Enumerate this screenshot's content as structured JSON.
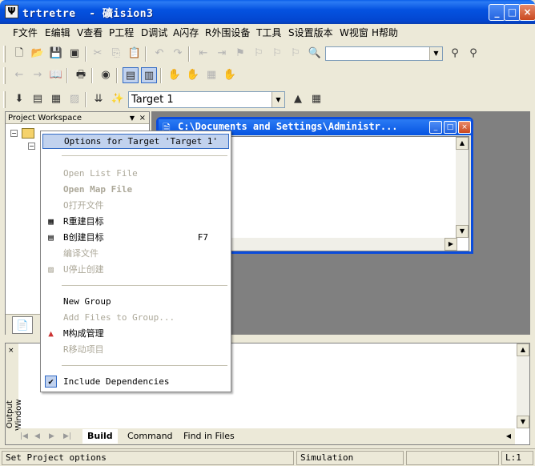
{
  "window": {
    "title": "trtretre  - 礦ision3",
    "app_icon": "Ψ",
    "controls": {
      "minimize": "_",
      "maximize": "□",
      "close": "×"
    }
  },
  "menubar": [
    {
      "label": "F文件"
    },
    {
      "label": "E编辑"
    },
    {
      "label": "V查看"
    },
    {
      "label": "P工程"
    },
    {
      "label": "D调试"
    },
    {
      "label": "A闪存"
    },
    {
      "label": "R外围设备"
    },
    {
      "label": "T工具"
    },
    {
      "label": "S设置版本"
    },
    {
      "label": "W视窗"
    },
    {
      "label": "H帮助"
    }
  ],
  "toolbar": {
    "find_combo_value": "",
    "target_combo_value": "Target 1"
  },
  "project_workspace": {
    "title": "Project Workspace",
    "close": "×"
  },
  "editor_window": {
    "title": "C:\\Documents and Settings\\Administr..."
  },
  "context_menu": {
    "items": [
      {
        "label": "Options for Target 'Target 1'",
        "shortcut": "",
        "enabled": true,
        "highlighted": true,
        "icon": ""
      },
      {
        "label": "Open List File",
        "shortcut": "",
        "enabled": false,
        "icon": ""
      },
      {
        "label": "Open Map File",
        "shortcut": "",
        "enabled": false,
        "icon": ""
      },
      {
        "label": "O打开文件",
        "shortcut": "",
        "enabled": false,
        "icon": ""
      },
      {
        "label": "R重建目标",
        "shortcut": "",
        "enabled": true,
        "icon": "rebuild-icon"
      },
      {
        "label": "B创建目标",
        "shortcut": "F7",
        "enabled": true,
        "icon": "build-icon"
      },
      {
        "label": "编译文件",
        "shortcut": "",
        "enabled": false,
        "icon": ""
      },
      {
        "label": "U停止创建",
        "shortcut": "",
        "enabled": false,
        "icon": "stop-build-icon"
      },
      {
        "label": "New Group",
        "shortcut": "",
        "enabled": true,
        "icon": ""
      },
      {
        "label": "Add Files to Group...",
        "shortcut": "",
        "enabled": false,
        "icon": ""
      },
      {
        "label": "M构成管理",
        "shortcut": "",
        "enabled": true,
        "icon": "components-icon"
      },
      {
        "label": "R移动项目",
        "shortcut": "",
        "enabled": false,
        "icon": ""
      },
      {
        "label": "Include Dependencies",
        "shortcut": "",
        "enabled": true,
        "checked": true,
        "icon": "check-icon"
      }
    ]
  },
  "output_window": {
    "title": "Output Window",
    "tabs": [
      {
        "label": "Build",
        "active": true
      },
      {
        "label": "Command"
      },
      {
        "label": "Find in Files"
      }
    ]
  },
  "statusbar": {
    "message": "Set Project options",
    "mode": "Simulation",
    "line": "L:1"
  },
  "colors": {
    "titlebar": "#0553e1",
    "menu_highlight": "#c1d2ee",
    "menu_highlight_border": "#316ac5",
    "mdi_background": "#808080",
    "chrome": "#ece9d8"
  }
}
